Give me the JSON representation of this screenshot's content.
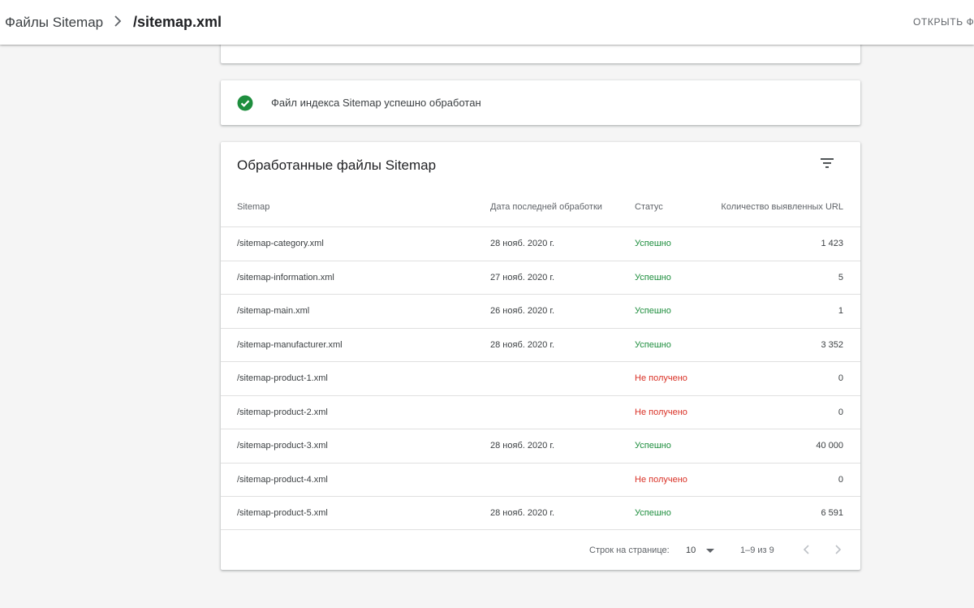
{
  "header": {
    "breadcrumb_parent": "Файлы Sitemap",
    "breadcrumb_current": "/sitemap.xml",
    "open_link": "ОТКРЫТЬ ФАЙЛ",
    "separator_icon": "chevron-right-icon"
  },
  "status_card": {
    "icon": "check-circle-icon",
    "icon_color": "#1e8e3e",
    "text": "Файл индекса Sitemap успешно обработан"
  },
  "table": {
    "title": "Обработанные файлы Sitemap",
    "filter_icon": "filter-list-icon",
    "columns": {
      "sitemap": "Sitemap",
      "date": "Дата последней обработки",
      "status": "Статус",
      "count": "Количество выявленных URL"
    },
    "rows": [
      {
        "path": "/sitemap-category.xml",
        "date": "28 нояб. 2020 г.",
        "status": "Успешно",
        "count": "1 423"
      },
      {
        "path": "/sitemap-information.xml",
        "date": "27 нояб. 2020 г.",
        "status": "Успешно",
        "count": "5"
      },
      {
        "path": "/sitemap-main.xml",
        "date": "26 нояб. 2020 г.",
        "status": "Успешно",
        "count": "1"
      },
      {
        "path": "/sitemap-manufacturer.xml",
        "date": "28 нояб. 2020 г.",
        "status": "Успешно",
        "count": "3 352"
      },
      {
        "path": "/sitemap-product-1.xml",
        "date": "",
        "status": "Не получено",
        "count": "0"
      },
      {
        "path": "/sitemap-product-2.xml",
        "date": "",
        "status": "Не получено",
        "count": "0"
      },
      {
        "path": "/sitemap-product-3.xml",
        "date": "28 нояб. 2020 г.",
        "status": "Успешно",
        "count": "40 000"
      },
      {
        "path": "/sitemap-product-4.xml",
        "date": "",
        "status": "Не получено",
        "count": "0"
      },
      {
        "path": "/sitemap-product-5.xml",
        "date": "28 нояб. 2020 г.",
        "status": "Успешно",
        "count": "6 591"
      }
    ],
    "status_colors": {
      "success": "#1e8e3e",
      "error": "#d93025"
    }
  },
  "pagination": {
    "rows_per_page_label": "Строк на странице:",
    "rows_per_page_value": "10",
    "range": "1–9 из 9",
    "prev_icon": "chevron-left-icon",
    "next_icon": "chevron-right-icon"
  }
}
